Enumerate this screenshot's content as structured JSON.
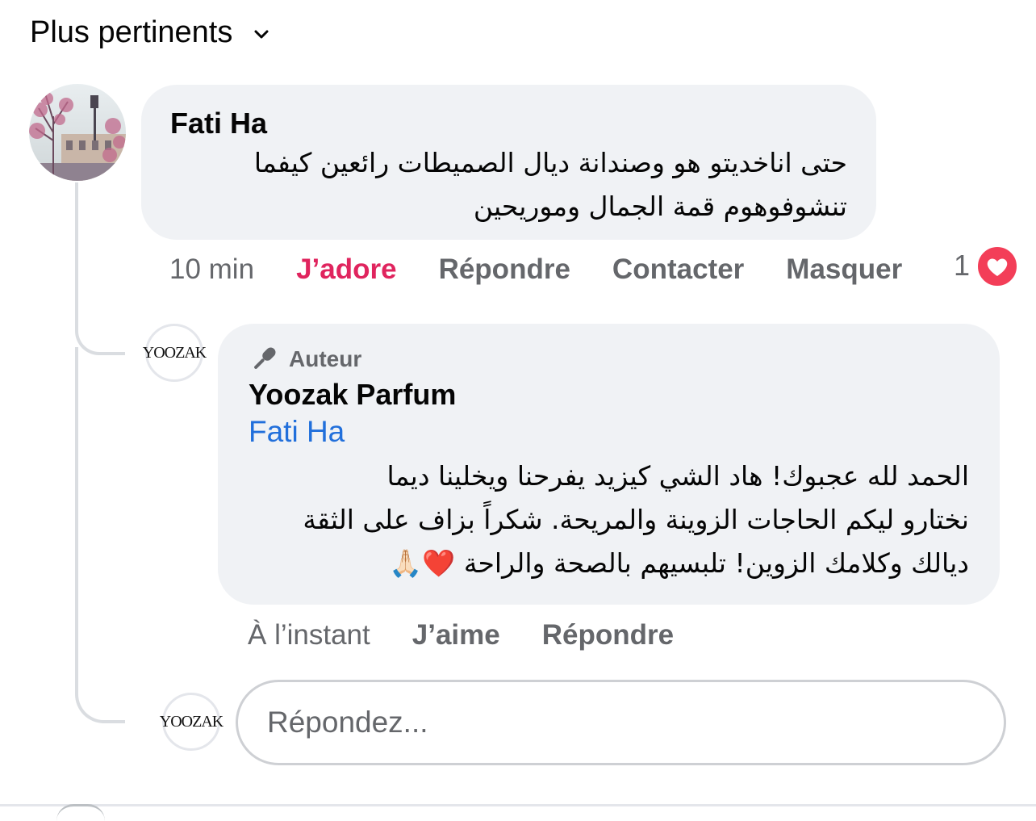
{
  "sort": {
    "label": "Plus pertinents",
    "icon": "chevron-down-icon"
  },
  "comment": {
    "author": "Fati Ha",
    "text": "حتى اناخديتو هو وصندانة ديال الصميطات  رائعين كيفما\nتنشوفوهوم قمة الجمال وموريحين",
    "time": "10 min",
    "actions": {
      "love": "J’adore",
      "reply": "Répondre",
      "contact": "Contacter",
      "hide": "Masquer"
    },
    "reaction_count": "1",
    "reaction_icon": "heart-icon"
  },
  "reply": {
    "badge": "Auteur",
    "badge_icon": "microphone-icon",
    "author": "Yoozak Parfum",
    "mention": "Fati Ha",
    "text": "الحمد لله عجبوك! هاد الشي كيزيد يفرحنا ويخلينا ديما\nنختارو ليكم الحاجات الزوينة والمريحة. شكراً بزاف على الثقة\nديالك وكلامك الزوين! تلبسيهم بالصحة والراحة ❤️🙏🏻",
    "time": "À l’instant",
    "actions": {
      "like": "J’aime",
      "reply": "Répondre"
    },
    "logo_text": "YOOZAK"
  },
  "composer": {
    "placeholder": "Répondez...",
    "logo_text": "YOOZAK"
  },
  "colors": {
    "love": "#e0245e",
    "mention": "#216fdb",
    "bubble": "#f0f2f5",
    "muted": "#65676b"
  }
}
